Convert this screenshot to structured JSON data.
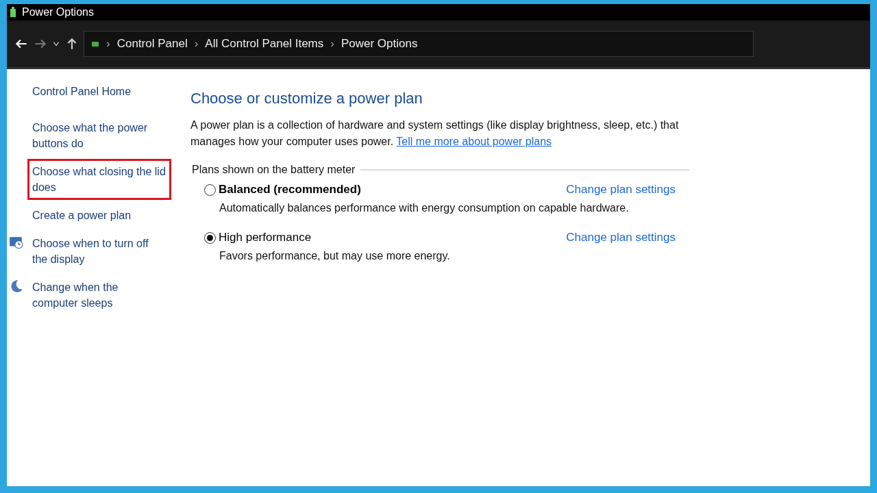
{
  "window": {
    "title": "Power Options"
  },
  "address_bar": {
    "breadcrumbs": [
      "Control Panel",
      "All Control Panel Items",
      "Power Options"
    ],
    "separator": "›"
  },
  "sidebar": {
    "items": [
      {
        "label": "Control Panel Home",
        "kind": "home",
        "highlighted": false
      },
      {
        "label": "Choose what the power buttons do",
        "kind": "link",
        "highlighted": false
      },
      {
        "label": "Choose what closing the lid does",
        "kind": "link",
        "highlighted": true
      },
      {
        "label": "Create a power plan",
        "kind": "link",
        "highlighted": false
      },
      {
        "label": "Choose when to turn off the display",
        "kind": "monitor",
        "highlighted": false
      },
      {
        "label": "Change when the computer sleeps",
        "kind": "moon",
        "highlighted": false
      }
    ]
  },
  "main": {
    "heading": "Choose or customize a power plan",
    "intro": "A power plan is a collection of hardware and system settings (like display brightness, sleep, etc.) that manages how your computer uses power.",
    "intro_link": "Tell me more about power plans",
    "group_title": "Plans shown on the battery meter",
    "plans": [
      {
        "name": "Balanced (recommended)",
        "bold": true,
        "selected": false,
        "description": "Automatically balances performance with energy consumption on capable hardware.",
        "link": "Change plan settings"
      },
      {
        "name": "High performance",
        "bold": false,
        "selected": true,
        "description": "Favors performance, but may use more energy.",
        "link": "Change plan settings"
      }
    ]
  }
}
